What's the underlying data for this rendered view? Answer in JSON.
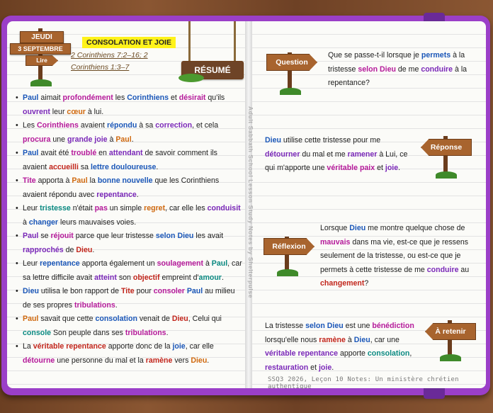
{
  "day": {
    "name": "JEUDI",
    "date": "3 SEPTEMBRE",
    "action": "Lire"
  },
  "lesson_title": "CONSOLATION ET JOIE",
  "scripture_ref": "2 Corinthiens 7:2–16; 2 Corinthiens 1:3–7",
  "summary_sign": "RÉSUMÉ",
  "spine_text": "Adult Sabbath School Lesson Study Notes by Shelterpulse",
  "bullets": [
    [
      [
        "Paul",
        "kb"
      ],
      [
        " aimait ",
        ""
      ],
      [
        "profondément",
        "km"
      ],
      [
        " les ",
        ""
      ],
      [
        "Corinthiens",
        "kb"
      ],
      [
        " et ",
        ""
      ],
      [
        "désirait",
        "km"
      ],
      [
        " qu'ils ",
        ""
      ],
      [
        "ouvrent",
        "kp"
      ],
      [
        " leur ",
        ""
      ],
      [
        "cœur",
        "ko"
      ],
      [
        " à lui.",
        ""
      ]
    ],
    [
      [
        "Les ",
        ""
      ],
      [
        "Corinthiens",
        "km"
      ],
      [
        " avaient ",
        ""
      ],
      [
        "répondu",
        "kb"
      ],
      [
        " à sa ",
        ""
      ],
      [
        "correction",
        "kp"
      ],
      [
        ", et cela ",
        ""
      ],
      [
        "procura",
        "km"
      ],
      [
        " une ",
        ""
      ],
      [
        "grande joie",
        "kp"
      ],
      [
        " à ",
        ""
      ],
      [
        "Paul",
        "ko"
      ],
      [
        ".",
        ""
      ]
    ],
    [
      [
        "Paul",
        "kb"
      ],
      [
        " avait été ",
        ""
      ],
      [
        "troublé",
        "km"
      ],
      [
        " en ",
        ""
      ],
      [
        "attendant",
        "kp"
      ],
      [
        " de savoir comment ils avaient ",
        ""
      ],
      [
        "accueilli",
        "kr"
      ],
      [
        " sa ",
        ""
      ],
      [
        "lettre douloureuse",
        "kb"
      ],
      [
        ".",
        ""
      ]
    ],
    [
      [
        "Tite",
        "km"
      ],
      [
        " apporta à ",
        ""
      ],
      [
        "Paul",
        "ko"
      ],
      [
        " la ",
        ""
      ],
      [
        "bonne nouvelle",
        "kb"
      ],
      [
        " que les Corinthiens avaient répondu avec ",
        ""
      ],
      [
        "repentance",
        "kp"
      ],
      [
        ".",
        ""
      ]
    ],
    [
      [
        "Leur ",
        ""
      ],
      [
        "tristesse",
        "kt"
      ],
      [
        " n'était ",
        ""
      ],
      [
        "pas",
        "km"
      ],
      [
        " un simple ",
        ""
      ],
      [
        "regret",
        "ko"
      ],
      [
        ", car elle les ",
        ""
      ],
      [
        "conduisit",
        "kp"
      ],
      [
        " à ",
        ""
      ],
      [
        "changer",
        "kb"
      ],
      [
        " leurs mauvaises voies.",
        ""
      ]
    ],
    [
      [
        "Paul",
        "kp"
      ],
      [
        " se ",
        ""
      ],
      [
        "réjouit",
        "km"
      ],
      [
        " parce que leur tristesse ",
        ""
      ],
      [
        "selon Dieu",
        "kb"
      ],
      [
        " les avait ",
        ""
      ],
      [
        "rapprochés",
        "kp"
      ],
      [
        " de ",
        ""
      ],
      [
        "Dieu",
        "kr"
      ],
      [
        ".",
        ""
      ]
    ],
    [
      [
        "Leur ",
        ""
      ],
      [
        "repentance",
        "kb"
      ],
      [
        " apporta également un ",
        ""
      ],
      [
        "soulagement",
        "km"
      ],
      [
        " à ",
        ""
      ],
      [
        "Paul",
        "kt"
      ],
      [
        ", car sa lettre difficile avait ",
        ""
      ],
      [
        "atteint",
        "kp"
      ],
      [
        " son ",
        ""
      ],
      [
        "objectif",
        "kr"
      ],
      [
        " empreint d'",
        ""
      ],
      [
        "amour",
        "kt"
      ],
      [
        ".",
        ""
      ]
    ],
    [
      [
        "Dieu",
        "kb"
      ],
      [
        " utilisa le bon rapport de ",
        ""
      ],
      [
        "Tite",
        "kr"
      ],
      [
        " pour ",
        ""
      ],
      [
        "consoler",
        "km"
      ],
      [
        " ",
        ""
      ],
      [
        "Paul",
        "kb"
      ],
      [
        " au milieu de ses propres ",
        ""
      ],
      [
        "tribulations",
        "km"
      ],
      [
        ".",
        ""
      ]
    ],
    [
      [
        "Paul",
        "ko"
      ],
      [
        " savait que cette ",
        ""
      ],
      [
        "consolation",
        "kb"
      ],
      [
        " venait de ",
        ""
      ],
      [
        "Dieu",
        "kr"
      ],
      [
        ", Celui qui ",
        ""
      ],
      [
        "console",
        "kt"
      ],
      [
        " Son peuple dans ses ",
        ""
      ],
      [
        "tribulations",
        "km"
      ],
      [
        ".",
        ""
      ]
    ],
    [
      [
        "La ",
        ""
      ],
      [
        "véritable repentance",
        "kr"
      ],
      [
        " apporte donc de la ",
        ""
      ],
      [
        "joie",
        "kb"
      ],
      [
        ", car elle ",
        ""
      ],
      [
        "détourne",
        "km"
      ],
      [
        " une personne du mal et la ",
        ""
      ],
      [
        "ramène",
        "kr"
      ],
      [
        " vers ",
        ""
      ],
      [
        "Dieu",
        "ko"
      ],
      [
        ".",
        ""
      ]
    ]
  ],
  "sections": {
    "question": {
      "label": "Question",
      "text": [
        [
          "Que se passe-t-il lorsque je ",
          ""
        ],
        [
          "permets",
          "kb"
        ],
        [
          " à la tristesse ",
          ""
        ],
        [
          "selon Dieu",
          "km"
        ],
        [
          " de me ",
          ""
        ],
        [
          "conduire",
          "kp"
        ],
        [
          " à la repentance?",
          ""
        ]
      ]
    },
    "answer": {
      "label": "Réponse",
      "text": [
        [
          "Dieu",
          "kb"
        ],
        [
          " utilise cette tristesse pour me ",
          ""
        ],
        [
          "détourner",
          "kp"
        ],
        [
          " du mal et me ",
          ""
        ],
        [
          "ramener",
          "kp"
        ],
        [
          " à Lui, ce qui m'apporte une ",
          ""
        ],
        [
          "véritable paix",
          "km"
        ],
        [
          " et ",
          ""
        ],
        [
          "joie",
          "kp"
        ],
        [
          ".",
          ""
        ]
      ]
    },
    "reflection": {
      "label": "Réflexion",
      "text": [
        [
          "Lorsque ",
          ""
        ],
        [
          "Dieu",
          "kb"
        ],
        [
          " me montre quelque chose de ",
          ""
        ],
        [
          "mauvais",
          "km"
        ],
        [
          " dans ma vie, est-ce que je ressens seulement de la tristesse, ou est-ce que je permets à cette tristesse de me ",
          ""
        ],
        [
          "conduire",
          "kp"
        ],
        [
          " au ",
          ""
        ],
        [
          "changement",
          "kr"
        ],
        [
          "?",
          ""
        ]
      ]
    },
    "retain": {
      "label": "À retenir",
      "text": [
        [
          "La tristesse ",
          ""
        ],
        [
          "selon Dieu",
          "kb"
        ],
        [
          " est une ",
          ""
        ],
        [
          "bénédiction",
          "km"
        ],
        [
          " lorsqu'elle nous ",
          ""
        ],
        [
          "ramène",
          "kr"
        ],
        [
          " à ",
          ""
        ],
        [
          "Dieu",
          "kb"
        ],
        [
          ", car une ",
          ""
        ],
        [
          "véritable repentance",
          "kp"
        ],
        [
          " apporte ",
          ""
        ],
        [
          "consolation",
          "kt"
        ],
        [
          ", ",
          ""
        ],
        [
          "restauration",
          "kp"
        ],
        [
          " et ",
          ""
        ],
        [
          "joie",
          "kp"
        ],
        [
          ".",
          ""
        ]
      ]
    }
  },
  "footer": "SSQ3 2026, Leçon 10 Notes: Un ministère chrétien authentique",
  "colors": {
    "cover": "#9b3fc8",
    "highlight": "#fff21a",
    "sign_wood": "#a8642e"
  }
}
